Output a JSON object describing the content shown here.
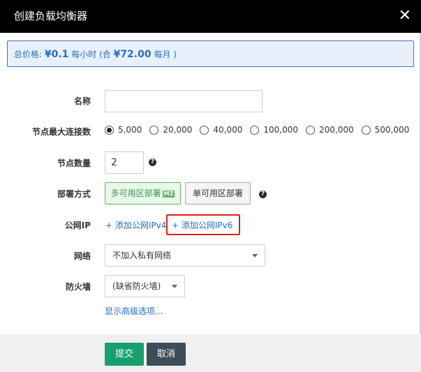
{
  "dialog": {
    "title": "创建负载均衡器",
    "close_glyph": "✕"
  },
  "price": {
    "prefix": "总价格:",
    "hourly": "¥0.1",
    "hourly_unit": "每小时 (合",
    "monthly": "¥72.00",
    "monthly_unit": "每月 )"
  },
  "form": {
    "name": {
      "label": "名称",
      "value": "",
      "placeholder": ""
    },
    "max_conn": {
      "label": "节点最大连接数",
      "selected": "5,000",
      "options": [
        "5,000",
        "20,000",
        "40,000",
        "100,000",
        "200,000",
        "500,000"
      ]
    },
    "node_count": {
      "label": "节点数量",
      "value": "2",
      "help_icon": "question-circle-icon"
    },
    "deploy": {
      "label": "部署方式",
      "multi_label": "多可用区部署",
      "multi_badge": "MZ",
      "single_label": "单可用区部署",
      "help_icon": "question-circle-icon"
    },
    "public_ip": {
      "label": "公网IP",
      "add_ipv4": "+ 添加公网IPv4",
      "add_ipv6": "+ 添加公网IPv6"
    },
    "network": {
      "label": "网络",
      "selected": "不加入私有网络"
    },
    "firewall": {
      "label": "防火墙",
      "selected": "(缺省防火墙)"
    },
    "advanced_link": "显示高级选项..."
  },
  "footer": {
    "submit_label": "提交",
    "cancel_label": "取消"
  },
  "colors": {
    "header_bg": "#000000",
    "price_border": "#3577c0",
    "link": "#1e6fbf",
    "submit": "#189f6e",
    "cancel": "#3f4d58",
    "highlight": "#e0201b",
    "mz_green": "#5cb85c"
  }
}
